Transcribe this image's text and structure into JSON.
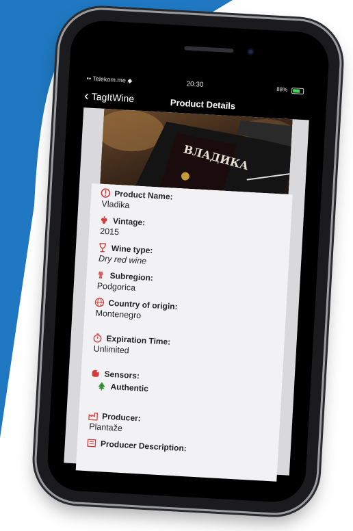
{
  "status": {
    "carrier": "Telekom.me",
    "time": "20:30",
    "battery": "88%"
  },
  "navbar": {
    "back_label": "TagItWine",
    "title": "Product Details"
  },
  "bottle_label": "ВЛАДИКА",
  "fields": {
    "product_name": {
      "label": "Product Name:",
      "value": "Vladika"
    },
    "vintage": {
      "label": "Vintage:",
      "value": "2015"
    },
    "wine_type": {
      "label": "Wine type:",
      "value": "Dry red wine"
    },
    "subregion": {
      "label": "Subregion:",
      "value": "Podgorica"
    },
    "country": {
      "label": "Country of origin:",
      "value": "Montenegro"
    },
    "expiration": {
      "label": "Expiration Time:",
      "value": "Unlimited"
    },
    "sensors": {
      "label": "Sensors:",
      "value": "Authentic"
    },
    "producer": {
      "label": "Producer:",
      "value": "Plantaže"
    },
    "producer_description": {
      "label": "Producer Description:"
    }
  },
  "colors": {
    "background_blue": "#1f78c1",
    "accent_red": "#d63a3a",
    "authentic_green": "#3c8c35"
  }
}
